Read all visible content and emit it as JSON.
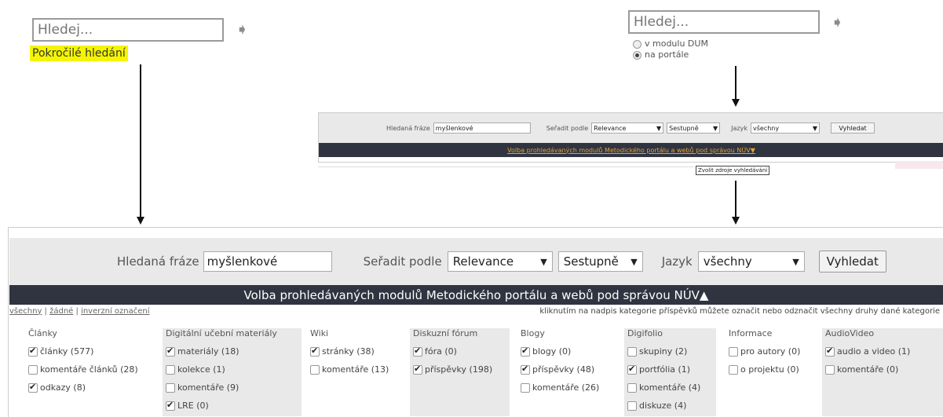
{
  "left_search": {
    "placeholder": "Hledej...",
    "advanced_link": "Pokročilé hledání"
  },
  "right_search": {
    "placeholder": "Hledej...",
    "options": [
      {
        "label": "v modulu DUM",
        "selected": false
      },
      {
        "label": "na portále",
        "selected": true
      }
    ]
  },
  "small_form": {
    "phrase_label": "Hledaná fráze",
    "phrase_value": "myšlenkové",
    "sort_label": "Seřadit podle",
    "sort_value": "Relevance",
    "order_value": "Sestupně",
    "lang_label": "Jazyk",
    "lang_value": "všechny",
    "submit_label": "Vyhledat",
    "modules_link": "Volba prohledávaných modulů Metodického portálu a webů pod správou NÚV▼",
    "tooltip": "Zvolit zdroje vyhledávání"
  },
  "big_form": {
    "phrase_label": "Hledaná fráze",
    "phrase_value": "myšlenkové",
    "sort_label": "Seřadit podle",
    "sort_value": "Relevance",
    "order_value": "Sestupně",
    "lang_label": "Jazyk",
    "lang_value": "všechny",
    "submit_label": "Vyhledat",
    "modules_bar": "Volba prohledávaných modulů Metodického portálu a webů pod správou NÚV▲",
    "select_all": "všechny",
    "select_none": "žádné",
    "select_invert": "inverzní označení",
    "hint": "kliknutím na nadpis kategorie příspěvků můžete označit nebo odznačit všechny druhy dané kategorie"
  },
  "categories": [
    {
      "title": "Články",
      "items": [
        {
          "label": "články (577)",
          "checked": true
        },
        {
          "label": "komentáře článků (28)",
          "checked": false
        },
        {
          "label": "odkazy (8)",
          "checked": true
        }
      ]
    },
    {
      "title": "Digitální učební materiály",
      "items": [
        {
          "label": "materiály (18)",
          "checked": true
        },
        {
          "label": "kolekce (1)",
          "checked": false
        },
        {
          "label": "komentáře (9)",
          "checked": false
        },
        {
          "label": "LRE (0)",
          "checked": true
        }
      ]
    },
    {
      "title": "Wiki",
      "items": [
        {
          "label": "stránky (38)",
          "checked": true
        },
        {
          "label": "komentáře (13)",
          "checked": false
        }
      ]
    },
    {
      "title": "Diskuzní fórum",
      "items": [
        {
          "label": "fóra (0)",
          "checked": true
        },
        {
          "label": "příspěvky (198)",
          "checked": true
        }
      ]
    },
    {
      "title": "Blogy",
      "items": [
        {
          "label": "blogy (0)",
          "checked": true
        },
        {
          "label": "příspěvky (48)",
          "checked": true
        },
        {
          "label": "komentáře (26)",
          "checked": false
        }
      ]
    },
    {
      "title": "Digifolio",
      "items": [
        {
          "label": "skupiny (2)",
          "checked": false
        },
        {
          "label": "portfólia (1)",
          "checked": true
        },
        {
          "label": "komentáře (4)",
          "checked": false
        },
        {
          "label": "diskuze (4)",
          "checked": false
        }
      ]
    },
    {
      "title": "Informace",
      "items": [
        {
          "label": "pro autory (0)",
          "checked": false
        },
        {
          "label": "o projektu (0)",
          "checked": false
        }
      ]
    },
    {
      "title": "AudioVideo",
      "items": [
        {
          "label": "audio a video (1)",
          "checked": true
        },
        {
          "label": "komentáře (0)",
          "checked": false
        }
      ]
    }
  ]
}
